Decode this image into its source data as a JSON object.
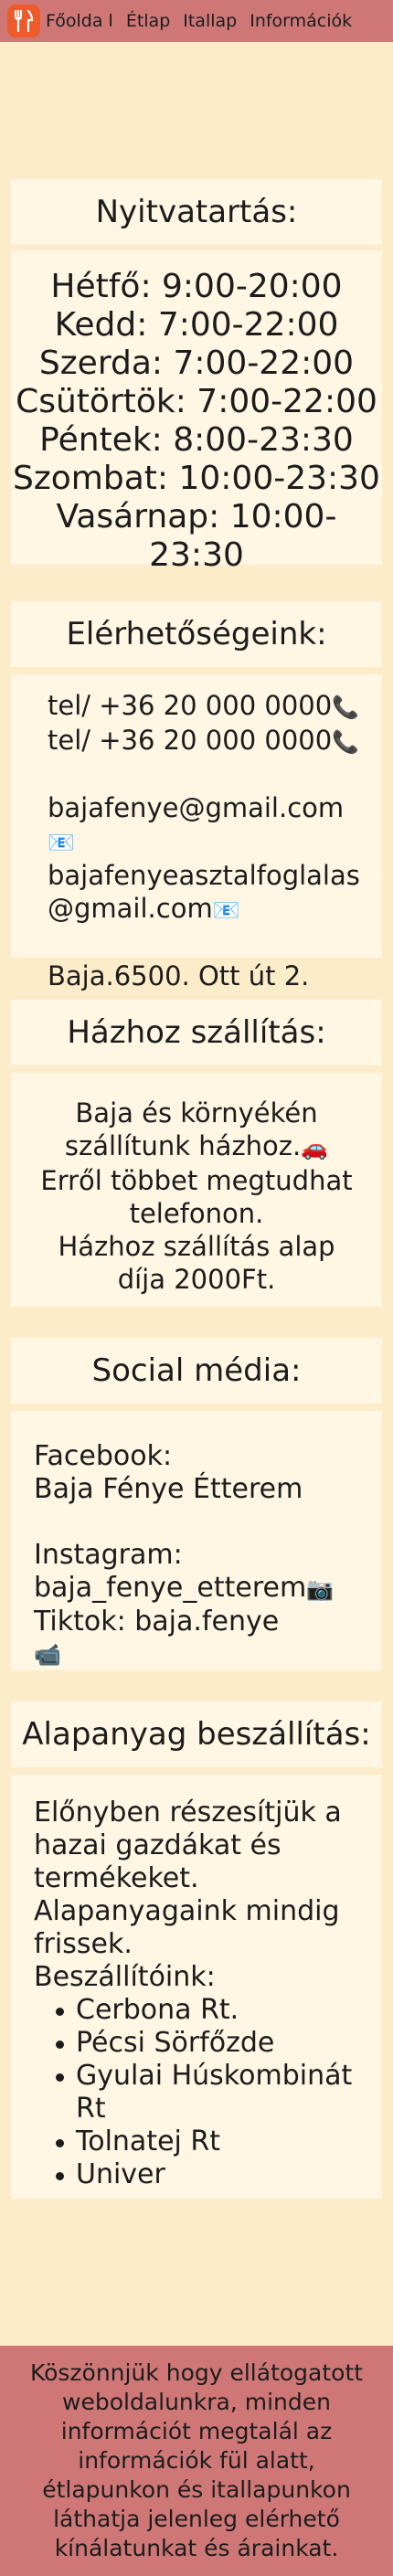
{
  "navbar": {
    "links": [
      "Főolda l",
      "Étlap",
      "Itallap",
      "Információk"
    ]
  },
  "hours": {
    "title": "Nyitvatartás:",
    "lines": [
      "Hétfő: 9:00-20:00",
      "Kedd: 7:00-22:00",
      "Szerda: 7:00-22:00",
      "Csütörtök: 7:00-22:00",
      "Péntek: 8:00-23:30",
      "Szombat: 10:00-23:30",
      "Vasárnap: 10:00-23:30"
    ]
  },
  "contact": {
    "title": "Elérhetőségeink:",
    "phone1": "tel/ +36 20 000 0000",
    "phone2": "tel/ +36 20 000 0000",
    "email1": "bajafenye@gmail.com",
    "email2": "bajafenyeasztalfoglalas@gmail.com",
    "address": "Baja.6500. Ott út 2."
  },
  "delivery": {
    "title": "Házhoz szállítás:",
    "line1": "Baja és környékén szállítunk házhoz.",
    "line2": "Erről többet megtudhat telefonon.",
    "line3": "Házhoz szállítás alap díja 2000Ft."
  },
  "social": {
    "title": "Social média:",
    "facebook_label": "Facebook:",
    "facebook_value": "Baja Fénye Étterem",
    "instagram_label": "Instagram:",
    "instagram_value": "baja_fenye_etterem",
    "tiktok": "Tiktok: baja.fenye"
  },
  "supply": {
    "title": "Alapanyag beszállítás:",
    "intro": "Előnyben részesítjük a hazai gazdákat és termékeket.",
    "fresh": "Alapanyagaink mindig frissek.",
    "suppliers_label": "Beszállítóink:",
    "suppliers": [
      "Cerbona Rt.",
      "Pécsi Sörfőzde",
      "Gyulai Húskombinát Rt",
      "Tolnatej Rt",
      "Univer"
    ]
  },
  "footer": {
    "text": "Köszönnjük hogy ellátogatott weboldalunkra, minden információt megtalál az információk fül alatt, étlapunkon és itallapunkon láthatja jelenleg elérhető kínálatunkat és árainkat."
  },
  "colors": {
    "background": "#fcecca",
    "card": "#fff6e3",
    "navbar": "#cf7777",
    "logo": "#ef5a2a"
  },
  "icons": [
    "fork-knife-icon",
    "phone-icon",
    "envelope-icon",
    "car-icon",
    "camera-icon",
    "video-camera-icon"
  ]
}
